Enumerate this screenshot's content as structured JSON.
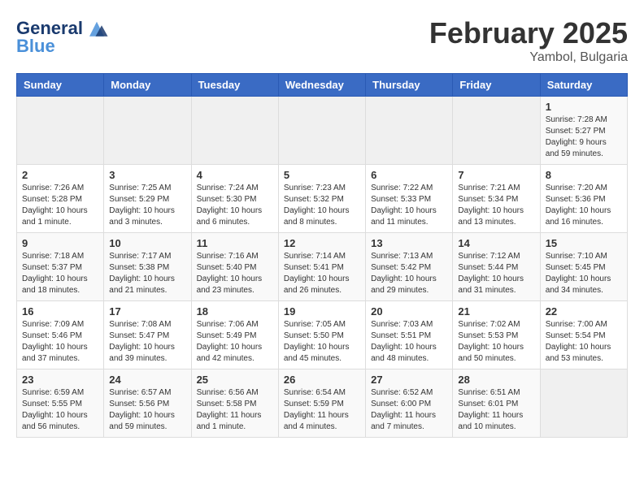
{
  "header": {
    "logo_line1": "General",
    "logo_line2": "Blue",
    "month_year": "February 2025",
    "location": "Yambol, Bulgaria"
  },
  "days_of_week": [
    "Sunday",
    "Monday",
    "Tuesday",
    "Wednesday",
    "Thursday",
    "Friday",
    "Saturday"
  ],
  "weeks": [
    [
      {
        "day": "",
        "info": ""
      },
      {
        "day": "",
        "info": ""
      },
      {
        "day": "",
        "info": ""
      },
      {
        "day": "",
        "info": ""
      },
      {
        "day": "",
        "info": ""
      },
      {
        "day": "",
        "info": ""
      },
      {
        "day": "1",
        "info": "Sunrise: 7:28 AM\nSunset: 5:27 PM\nDaylight: 9 hours\nand 59 minutes."
      }
    ],
    [
      {
        "day": "2",
        "info": "Sunrise: 7:26 AM\nSunset: 5:28 PM\nDaylight: 10 hours\nand 1 minute."
      },
      {
        "day": "3",
        "info": "Sunrise: 7:25 AM\nSunset: 5:29 PM\nDaylight: 10 hours\nand 3 minutes."
      },
      {
        "day": "4",
        "info": "Sunrise: 7:24 AM\nSunset: 5:30 PM\nDaylight: 10 hours\nand 6 minutes."
      },
      {
        "day": "5",
        "info": "Sunrise: 7:23 AM\nSunset: 5:32 PM\nDaylight: 10 hours\nand 8 minutes."
      },
      {
        "day": "6",
        "info": "Sunrise: 7:22 AM\nSunset: 5:33 PM\nDaylight: 10 hours\nand 11 minutes."
      },
      {
        "day": "7",
        "info": "Sunrise: 7:21 AM\nSunset: 5:34 PM\nDaylight: 10 hours\nand 13 minutes."
      },
      {
        "day": "8",
        "info": "Sunrise: 7:20 AM\nSunset: 5:36 PM\nDaylight: 10 hours\nand 16 minutes."
      }
    ],
    [
      {
        "day": "9",
        "info": "Sunrise: 7:18 AM\nSunset: 5:37 PM\nDaylight: 10 hours\nand 18 minutes."
      },
      {
        "day": "10",
        "info": "Sunrise: 7:17 AM\nSunset: 5:38 PM\nDaylight: 10 hours\nand 21 minutes."
      },
      {
        "day": "11",
        "info": "Sunrise: 7:16 AM\nSunset: 5:40 PM\nDaylight: 10 hours\nand 23 minutes."
      },
      {
        "day": "12",
        "info": "Sunrise: 7:14 AM\nSunset: 5:41 PM\nDaylight: 10 hours\nand 26 minutes."
      },
      {
        "day": "13",
        "info": "Sunrise: 7:13 AM\nSunset: 5:42 PM\nDaylight: 10 hours\nand 29 minutes."
      },
      {
        "day": "14",
        "info": "Sunrise: 7:12 AM\nSunset: 5:44 PM\nDaylight: 10 hours\nand 31 minutes."
      },
      {
        "day": "15",
        "info": "Sunrise: 7:10 AM\nSunset: 5:45 PM\nDaylight: 10 hours\nand 34 minutes."
      }
    ],
    [
      {
        "day": "16",
        "info": "Sunrise: 7:09 AM\nSunset: 5:46 PM\nDaylight: 10 hours\nand 37 minutes."
      },
      {
        "day": "17",
        "info": "Sunrise: 7:08 AM\nSunset: 5:47 PM\nDaylight: 10 hours\nand 39 minutes."
      },
      {
        "day": "18",
        "info": "Sunrise: 7:06 AM\nSunset: 5:49 PM\nDaylight: 10 hours\nand 42 minutes."
      },
      {
        "day": "19",
        "info": "Sunrise: 7:05 AM\nSunset: 5:50 PM\nDaylight: 10 hours\nand 45 minutes."
      },
      {
        "day": "20",
        "info": "Sunrise: 7:03 AM\nSunset: 5:51 PM\nDaylight: 10 hours\nand 48 minutes."
      },
      {
        "day": "21",
        "info": "Sunrise: 7:02 AM\nSunset: 5:53 PM\nDaylight: 10 hours\nand 50 minutes."
      },
      {
        "day": "22",
        "info": "Sunrise: 7:00 AM\nSunset: 5:54 PM\nDaylight: 10 hours\nand 53 minutes."
      }
    ],
    [
      {
        "day": "23",
        "info": "Sunrise: 6:59 AM\nSunset: 5:55 PM\nDaylight: 10 hours\nand 56 minutes."
      },
      {
        "day": "24",
        "info": "Sunrise: 6:57 AM\nSunset: 5:56 PM\nDaylight: 10 hours\nand 59 minutes."
      },
      {
        "day": "25",
        "info": "Sunrise: 6:56 AM\nSunset: 5:58 PM\nDaylight: 11 hours\nand 1 minute."
      },
      {
        "day": "26",
        "info": "Sunrise: 6:54 AM\nSunset: 5:59 PM\nDaylight: 11 hours\nand 4 minutes."
      },
      {
        "day": "27",
        "info": "Sunrise: 6:52 AM\nSunset: 6:00 PM\nDaylight: 11 hours\nand 7 minutes."
      },
      {
        "day": "28",
        "info": "Sunrise: 6:51 AM\nSunset: 6:01 PM\nDaylight: 11 hours\nand 10 minutes."
      },
      {
        "day": "",
        "info": ""
      }
    ]
  ]
}
